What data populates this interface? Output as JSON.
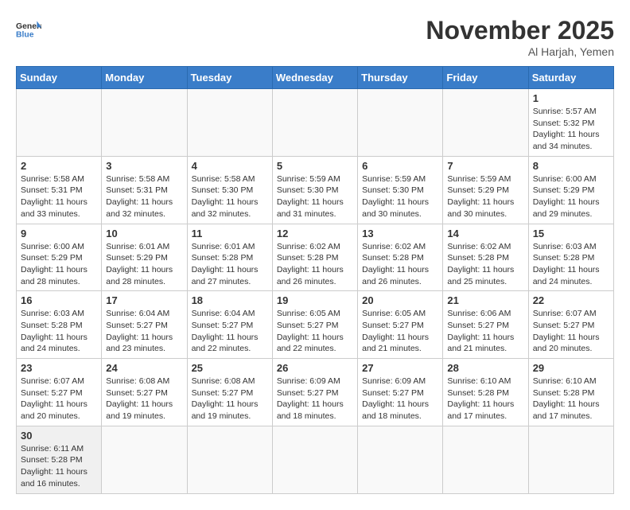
{
  "header": {
    "logo_general": "General",
    "logo_blue": "Blue",
    "month_year": "November 2025",
    "location": "Al Harjah, Yemen"
  },
  "days_of_week": [
    "Sunday",
    "Monday",
    "Tuesday",
    "Wednesday",
    "Thursday",
    "Friday",
    "Saturday"
  ],
  "weeks": [
    [
      {
        "day": null,
        "info": null
      },
      {
        "day": null,
        "info": null
      },
      {
        "day": null,
        "info": null
      },
      {
        "day": null,
        "info": null
      },
      {
        "day": null,
        "info": null
      },
      {
        "day": null,
        "info": null
      },
      {
        "day": "1",
        "info": "Sunrise: 5:57 AM\nSunset: 5:32 PM\nDaylight: 11 hours and 34 minutes."
      }
    ],
    [
      {
        "day": "2",
        "info": "Sunrise: 5:58 AM\nSunset: 5:31 PM\nDaylight: 11 hours and 33 minutes."
      },
      {
        "day": "3",
        "info": "Sunrise: 5:58 AM\nSunset: 5:31 PM\nDaylight: 11 hours and 32 minutes."
      },
      {
        "day": "4",
        "info": "Sunrise: 5:58 AM\nSunset: 5:30 PM\nDaylight: 11 hours and 32 minutes."
      },
      {
        "day": "5",
        "info": "Sunrise: 5:59 AM\nSunset: 5:30 PM\nDaylight: 11 hours and 31 minutes."
      },
      {
        "day": "6",
        "info": "Sunrise: 5:59 AM\nSunset: 5:30 PM\nDaylight: 11 hours and 30 minutes."
      },
      {
        "day": "7",
        "info": "Sunrise: 5:59 AM\nSunset: 5:29 PM\nDaylight: 11 hours and 30 minutes."
      },
      {
        "day": "8",
        "info": "Sunrise: 6:00 AM\nSunset: 5:29 PM\nDaylight: 11 hours and 29 minutes."
      }
    ],
    [
      {
        "day": "9",
        "info": "Sunrise: 6:00 AM\nSunset: 5:29 PM\nDaylight: 11 hours and 28 minutes."
      },
      {
        "day": "10",
        "info": "Sunrise: 6:01 AM\nSunset: 5:29 PM\nDaylight: 11 hours and 28 minutes."
      },
      {
        "day": "11",
        "info": "Sunrise: 6:01 AM\nSunset: 5:28 PM\nDaylight: 11 hours and 27 minutes."
      },
      {
        "day": "12",
        "info": "Sunrise: 6:02 AM\nSunset: 5:28 PM\nDaylight: 11 hours and 26 minutes."
      },
      {
        "day": "13",
        "info": "Sunrise: 6:02 AM\nSunset: 5:28 PM\nDaylight: 11 hours and 26 minutes."
      },
      {
        "day": "14",
        "info": "Sunrise: 6:02 AM\nSunset: 5:28 PM\nDaylight: 11 hours and 25 minutes."
      },
      {
        "day": "15",
        "info": "Sunrise: 6:03 AM\nSunset: 5:28 PM\nDaylight: 11 hours and 24 minutes."
      }
    ],
    [
      {
        "day": "16",
        "info": "Sunrise: 6:03 AM\nSunset: 5:28 PM\nDaylight: 11 hours and 24 minutes."
      },
      {
        "day": "17",
        "info": "Sunrise: 6:04 AM\nSunset: 5:27 PM\nDaylight: 11 hours and 23 minutes."
      },
      {
        "day": "18",
        "info": "Sunrise: 6:04 AM\nSunset: 5:27 PM\nDaylight: 11 hours and 22 minutes."
      },
      {
        "day": "19",
        "info": "Sunrise: 6:05 AM\nSunset: 5:27 PM\nDaylight: 11 hours and 22 minutes."
      },
      {
        "day": "20",
        "info": "Sunrise: 6:05 AM\nSunset: 5:27 PM\nDaylight: 11 hours and 21 minutes."
      },
      {
        "day": "21",
        "info": "Sunrise: 6:06 AM\nSunset: 5:27 PM\nDaylight: 11 hours and 21 minutes."
      },
      {
        "day": "22",
        "info": "Sunrise: 6:07 AM\nSunset: 5:27 PM\nDaylight: 11 hours and 20 minutes."
      }
    ],
    [
      {
        "day": "23",
        "info": "Sunrise: 6:07 AM\nSunset: 5:27 PM\nDaylight: 11 hours and 20 minutes."
      },
      {
        "day": "24",
        "info": "Sunrise: 6:08 AM\nSunset: 5:27 PM\nDaylight: 11 hours and 19 minutes."
      },
      {
        "day": "25",
        "info": "Sunrise: 6:08 AM\nSunset: 5:27 PM\nDaylight: 11 hours and 19 minutes."
      },
      {
        "day": "26",
        "info": "Sunrise: 6:09 AM\nSunset: 5:27 PM\nDaylight: 11 hours and 18 minutes."
      },
      {
        "day": "27",
        "info": "Sunrise: 6:09 AM\nSunset: 5:27 PM\nDaylight: 11 hours and 18 minutes."
      },
      {
        "day": "28",
        "info": "Sunrise: 6:10 AM\nSunset: 5:28 PM\nDaylight: 11 hours and 17 minutes."
      },
      {
        "day": "29",
        "info": "Sunrise: 6:10 AM\nSunset: 5:28 PM\nDaylight: 11 hours and 17 minutes."
      }
    ],
    [
      {
        "day": "30",
        "info": "Sunrise: 6:11 AM\nSunset: 5:28 PM\nDaylight: 11 hours and 16 minutes."
      },
      {
        "day": null,
        "info": null
      },
      {
        "day": null,
        "info": null
      },
      {
        "day": null,
        "info": null
      },
      {
        "day": null,
        "info": null
      },
      {
        "day": null,
        "info": null
      },
      {
        "day": null,
        "info": null
      }
    ]
  ]
}
